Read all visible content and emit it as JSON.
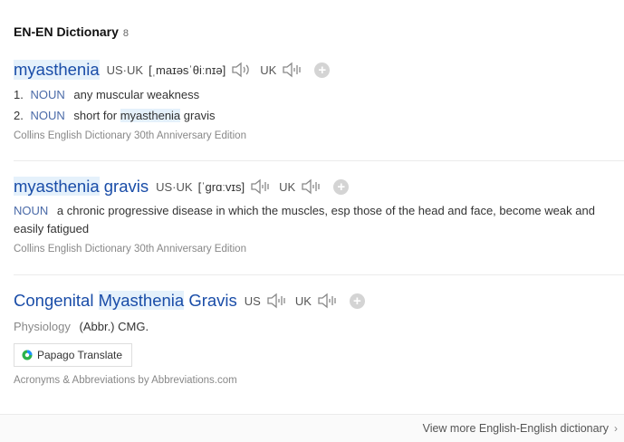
{
  "header": {
    "title": "EN-EN Dictionary",
    "count": "8"
  },
  "entries": [
    {
      "word": "myasthenia",
      "us_label": "US",
      "uk_label": "UK",
      "pronunciation": "[ˌmaɪəsˈθiːnɪə]",
      "definitions": [
        {
          "num": "1.",
          "pos": "NOUN",
          "text": "any muscular weakness"
        },
        {
          "num": "2.",
          "pos": "NOUN",
          "text_pre": "short for",
          "text_hl": "myasthenia",
          "text_post": "gravis"
        }
      ],
      "source": "Collins English Dictionary 30th Anniversary Edition"
    },
    {
      "word_hl": "myasthenia",
      "word_rest": "gravis",
      "us_label": "US",
      "uk_label": "UK",
      "pronunciation": "[ˈgrɑːvɪs]",
      "definition": {
        "pos": "NOUN",
        "text": "a chronic progressive disease in which the muscles, esp those of the head and face, become weak and easily fatigued"
      },
      "source": "Collins English Dictionary 30th Anniversary Edition"
    },
    {
      "word_pre": "Congenital",
      "word_hl": "Myasthenia",
      "word_post": "Gravis",
      "us_label": "US",
      "uk_label": "UK",
      "definition": {
        "pos": "Physiology",
        "text": "(Abbr.) CMG."
      },
      "papago_label": "Papago Translate",
      "source": "Acronyms & Abbreviations by Abbreviations.com"
    }
  ],
  "footer": {
    "more_label": "View more English-English dictionary"
  },
  "icons": {
    "speaker": "speaker-icon",
    "add": "plus-icon",
    "chevron": "chevron-right-icon",
    "papago": "papago-logo"
  }
}
